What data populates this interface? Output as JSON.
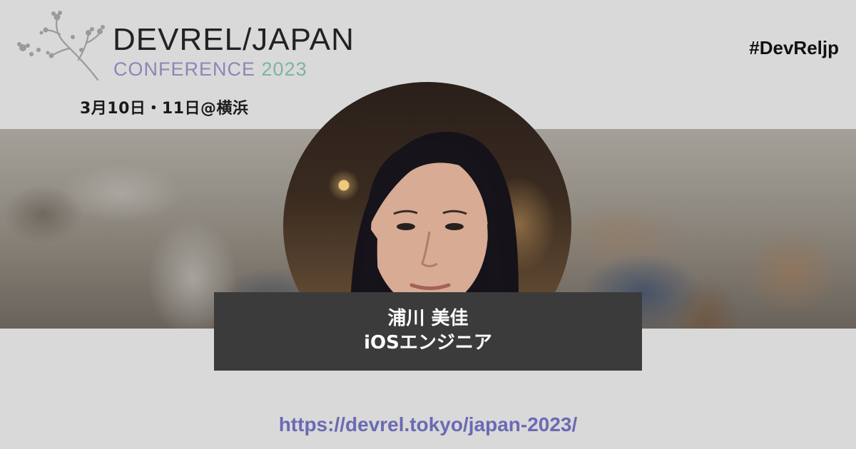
{
  "event": {
    "title": "DEVREL/JAPAN",
    "subtitle_word": "CONFERENCE",
    "subtitle_year": "2023",
    "date_location": "3月10日・11日@横浜",
    "hashtag": "#DevReljp",
    "url": "https://devrel.tokyo/japan-2023/"
  },
  "speaker": {
    "name": "浦川 美佳",
    "role": "iOSエンジニア"
  },
  "colors": {
    "background": "#d9d9d9",
    "name_box": "#3b3b3b",
    "subtitle": "#8a87b8",
    "year": "#7fb3a1",
    "url": "#6a6ab4"
  }
}
